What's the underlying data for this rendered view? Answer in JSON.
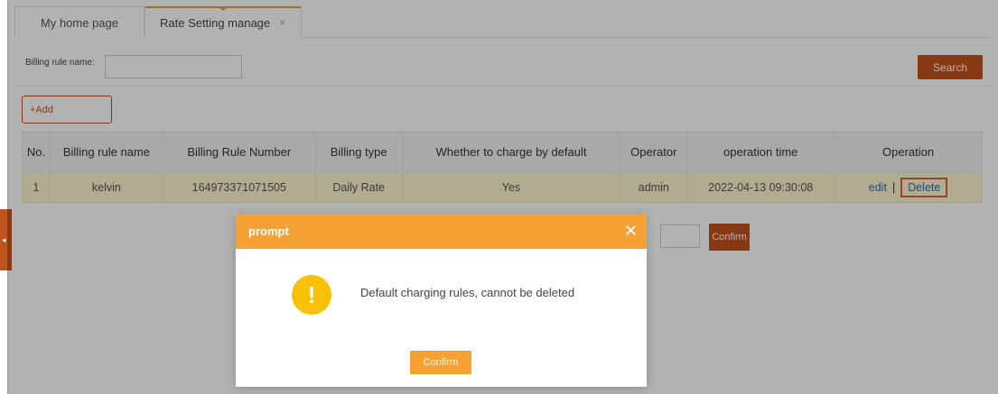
{
  "tabs": [
    {
      "label": "My home page"
    },
    {
      "label": "Rate Setting manage",
      "close": "×"
    }
  ],
  "search": {
    "label": "Billing rule name:",
    "value": "",
    "placeholder": "",
    "button_label": "Search"
  },
  "toolbar": {
    "add_label": "+Add"
  },
  "table": {
    "headers": [
      "No.",
      "Billing rule name",
      "Billing Rule Number",
      "Billing type",
      "Whether to charge by default",
      "Operator",
      "operation time",
      "Operation"
    ],
    "rows": [
      {
        "no": "1",
        "name": "kelvin",
        "number": "164973371071505",
        "type": "Daily Rate",
        "default": "Yes",
        "operator": "admin",
        "time": "2022-04-13 09:30:08",
        "edit": "edit",
        "sep": "|",
        "delete": "Delete"
      }
    ]
  },
  "pager": {
    "confirm_label": "Confirm"
  },
  "modal": {
    "title": "prompt",
    "close": "✕",
    "icon": "warning-icon",
    "icon_glyph": "!",
    "message": "Default charging rules, cannot be deleted",
    "confirm_label": "Confirm"
  },
  "colors": {
    "accent": "#c0521c",
    "modal_header": "#f5a133",
    "warning": "#f8c006",
    "row_highlight": "#fbf6cf"
  }
}
